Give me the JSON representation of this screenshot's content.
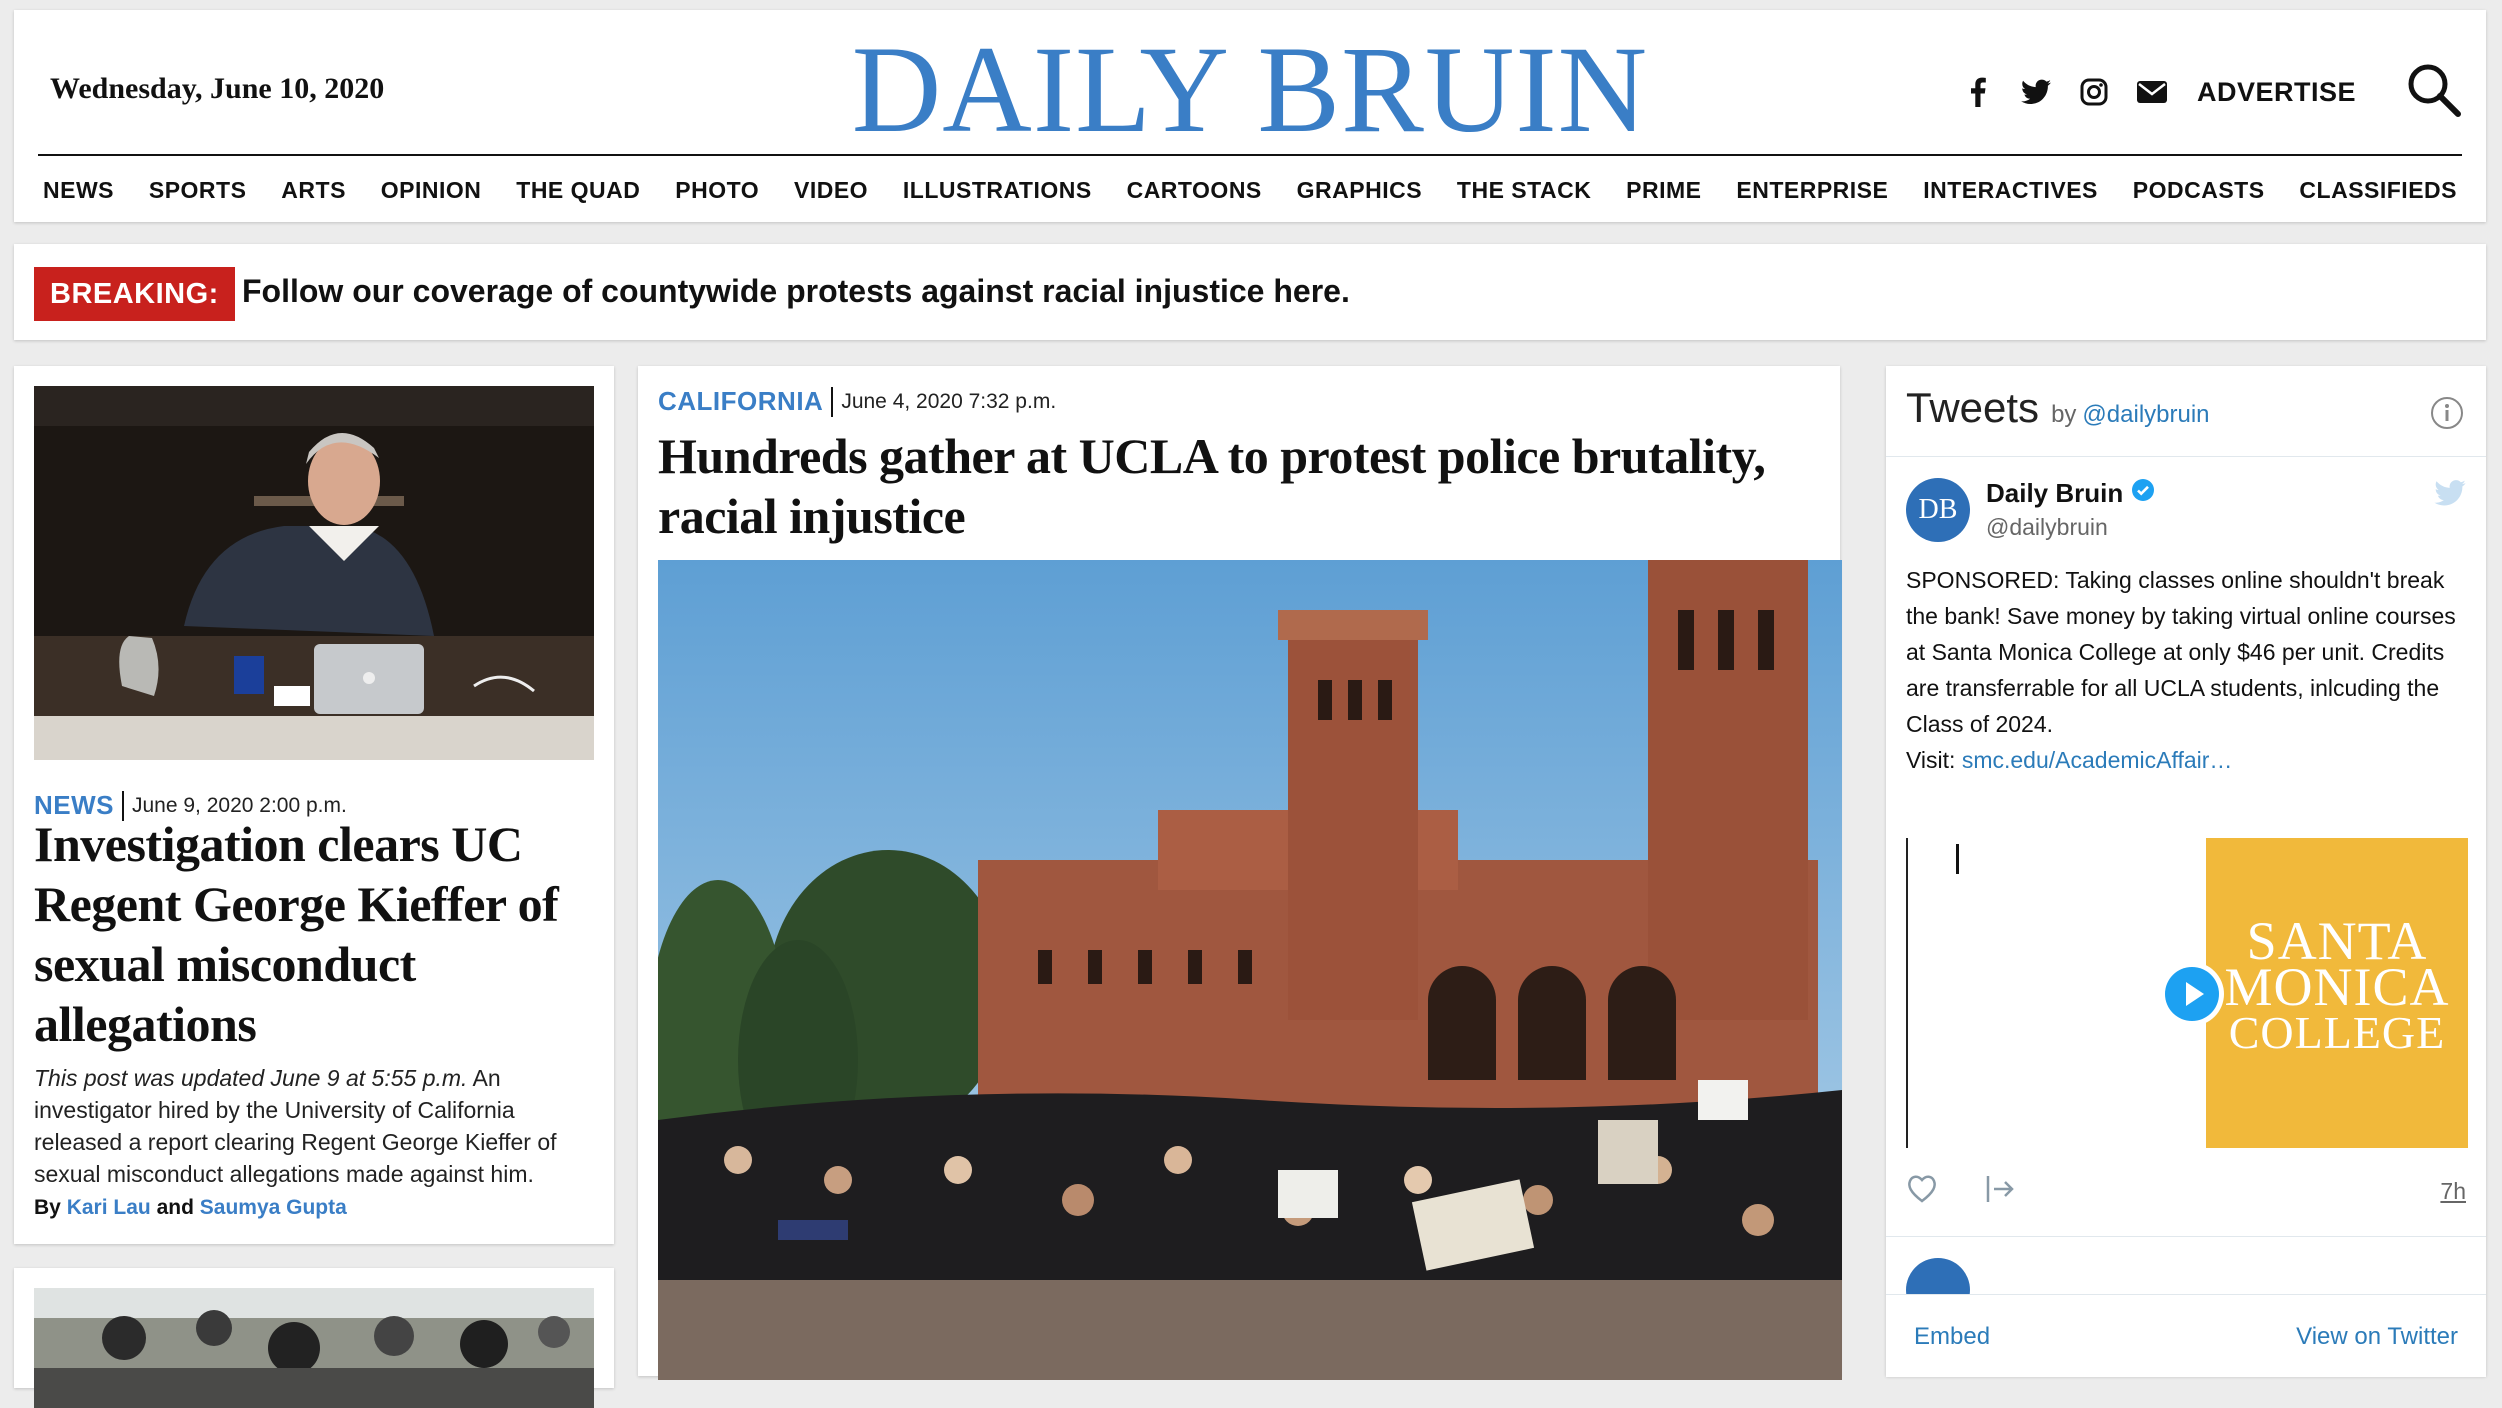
{
  "header": {
    "date": "Wednesday, June 10, 2020",
    "logo": "DAILY BRUIN",
    "social": [
      "facebook-icon",
      "twitter-icon",
      "instagram-icon",
      "mail-icon"
    ],
    "advertise": "ADVERTISE",
    "nav": [
      "NEWS",
      "SPORTS",
      "ARTS",
      "OPINION",
      "THE QUAD",
      "PHOTO",
      "VIDEO",
      "ILLUSTRATIONS",
      "CARTOONS",
      "GRAPHICS",
      "THE STACK",
      "PRIME",
      "ENTERPRISE",
      "INTERACTIVES",
      "PODCASTS",
      "CLASSIFIEDS"
    ]
  },
  "breaking": {
    "label": "BREAKING:",
    "text": "Follow our coverage of countywide protests against racial injustice here."
  },
  "left_story": {
    "section": "NEWS",
    "date": "June 9, 2020 2:00 p.m.",
    "headline": "Investigation clears UC Regent George Kieffer of sexual misconduct allegations",
    "summary_italic": "This post was updated June 9 at 5:55 p.m.",
    "summary": " An investigator hired by the University of California released a report clearing Regent George Kieffer of sexual misconduct allegations made against him.",
    "byline_prefix": "By",
    "author_1": "Kari Lau",
    "byline_and": "and",
    "author_2": "Saumya Gupta"
  },
  "center_story": {
    "section": "CALIFORNIA",
    "date": "June 4, 2020 7:32 p.m.",
    "headline": "Hundreds gather at UCLA to protest police brutality, racial injustice"
  },
  "tweets": {
    "title": "Tweets",
    "by": "by",
    "handle_link": "@dailybruin",
    "account_name": "Daily Bruin",
    "account_user": "@dailybruin",
    "avatar_initials": "DB",
    "text": "SPONSORED: Taking classes online shouldn't break the bank!  Save money by taking virtual online courses at Santa Monica College at only $46 per unit.  Credits are transferrable for all UCLA students, inlcuding the Class of 2024.",
    "visit_label": "Visit: ",
    "link": "smc.edu/AcademicAffair…",
    "media_text_1": "SANTA",
    "media_text_2": "MONICA",
    "media_text_3": "COLLEGE",
    "time": "7h",
    "embed": "Embed",
    "view_on_twitter": "View on Twitter"
  },
  "colors": {
    "brand_blue": "#3a7ec6",
    "breaking_red": "#c8211d",
    "twitter_blue": "#2b7bb9",
    "smc_gold": "#f1b93b"
  }
}
